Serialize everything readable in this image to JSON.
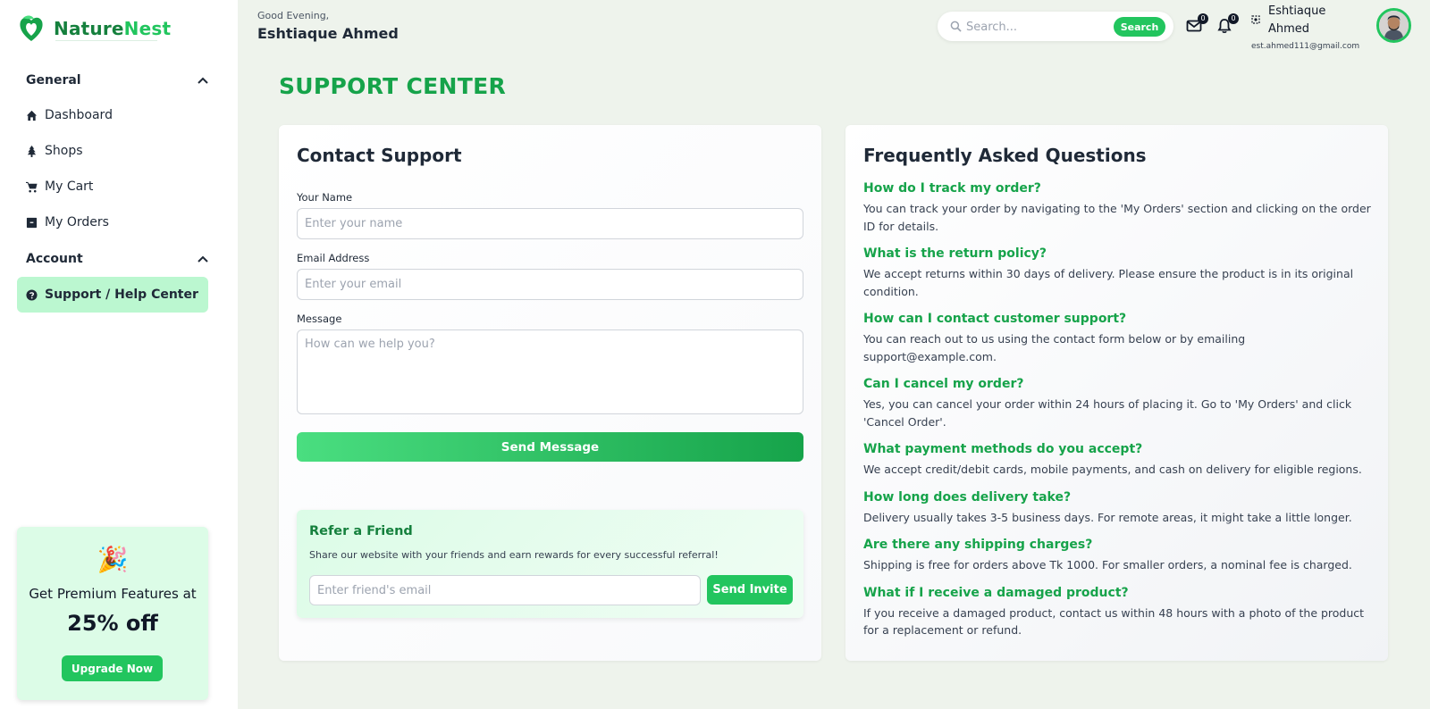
{
  "brand": {
    "name_part1": "Nature",
    "name_part2": "Nest"
  },
  "sidebar": {
    "sections": [
      {
        "title": "General",
        "items": [
          {
            "label": "Dashboard",
            "icon": "home-icon"
          },
          {
            "label": "Shops",
            "icon": "tree-icon"
          },
          {
            "label": "My Cart",
            "icon": "cart-icon"
          },
          {
            "label": "My Orders",
            "icon": "box-icon"
          }
        ]
      },
      {
        "title": "Account",
        "items": [
          {
            "label": "Support / Help Center",
            "icon": "question-circle-icon",
            "active": true
          }
        ]
      }
    ],
    "promo": {
      "emoji": "🎉",
      "line1": "Get Premium Features at",
      "line2": "25% off",
      "button": "Upgrade Now"
    }
  },
  "header": {
    "greeting": "Good Evening,",
    "user_name": "Eshtiaque Ahmed",
    "search_placeholder": "Search...",
    "search_button": "Search",
    "mail_count": "0",
    "notification_count": "0",
    "profile_name": "Eshtiaque Ahmed",
    "profile_email": "est.ahmed111@gmail.com"
  },
  "page": {
    "title": "SUPPORT CENTER"
  },
  "contact": {
    "title": "Contact Support",
    "name_label": "Your Name",
    "name_placeholder": "Enter your name",
    "email_label": "Email Address",
    "email_placeholder": "Enter your email",
    "message_label": "Message",
    "message_placeholder": "How can we help you?",
    "send_button": "Send Message"
  },
  "refer": {
    "title": "Refer a Friend",
    "description": "Share our website with your friends and earn rewards for every successful referral!",
    "input_placeholder": "Enter friend's email",
    "button": "Send Invite"
  },
  "faq": {
    "title": "Frequently Asked Questions",
    "items": [
      {
        "q": "How do I track my order?",
        "a": "You can track your order by navigating to the 'My Orders' section and clicking on the order ID for details."
      },
      {
        "q": "What is the return policy?",
        "a": "We accept returns within 30 days of delivery. Please ensure the product is in its original condition."
      },
      {
        "q": "How can I contact customer support?",
        "a": "You can reach out to us using the contact form below or by emailing support@example.com."
      },
      {
        "q": "Can I cancel my order?",
        "a": "Yes, you can cancel your order within 24 hours of placing it. Go to 'My Orders' and click 'Cancel Order'."
      },
      {
        "q": "What payment methods do you accept?",
        "a": "We accept credit/debit cards, mobile payments, and cash on delivery for eligible regions."
      },
      {
        "q": "How long does delivery take?",
        "a": "Delivery usually takes 3-5 business days. For remote areas, it might take a little longer."
      },
      {
        "q": "Are there any shipping charges?",
        "a": "Shipping is free for orders above Tk 1000. For smaller orders, a nominal fee is charged."
      },
      {
        "q": "What if I receive a damaged product?",
        "a": "If you receive a damaged product, contact us within 48 hours with a photo of the product for a replacement or refund."
      }
    ]
  },
  "colors": {
    "brand_green": "#16a34a",
    "accent_green": "#22c55e",
    "active_bg": "#bbf7d0",
    "page_bg": "#eef3ec"
  }
}
